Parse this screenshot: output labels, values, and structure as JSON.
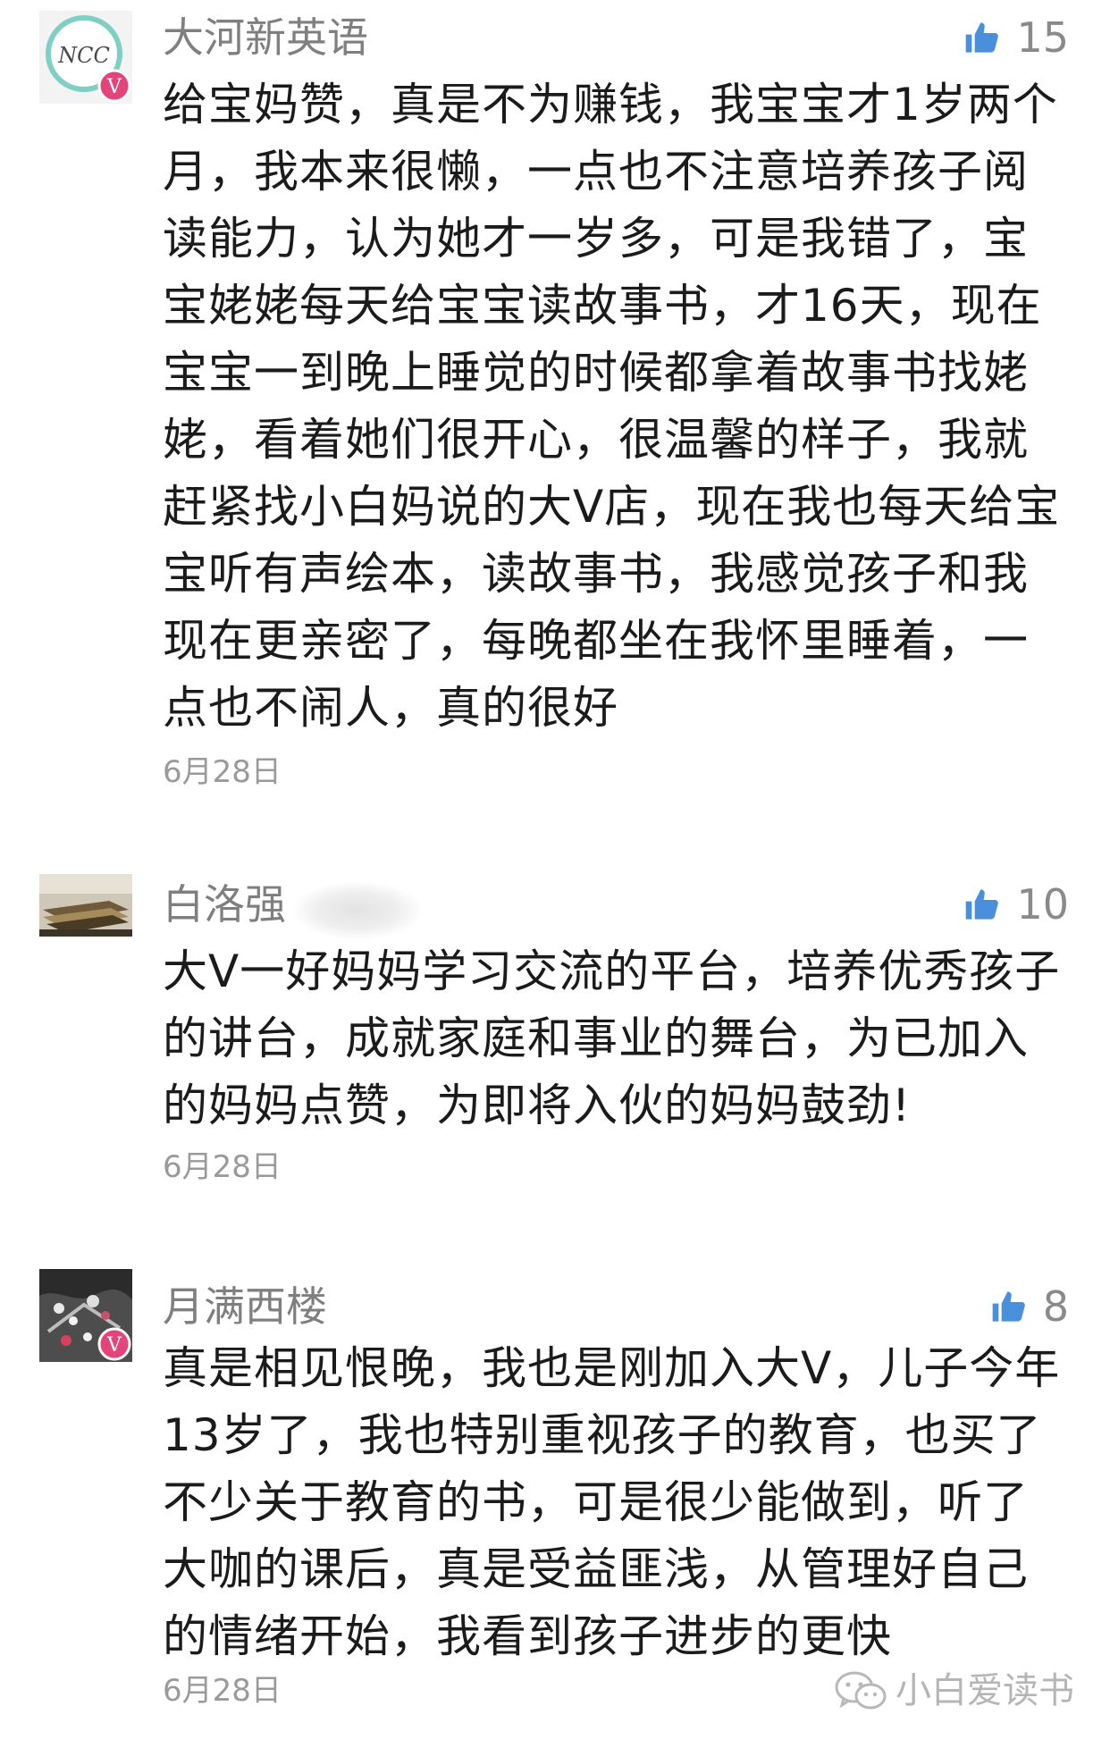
{
  "comments": [
    {
      "author": "大河新英语",
      "likes": "15",
      "avatar_badge": "V",
      "avatar_logo": "NCC",
      "lines": [
        "给宝妈赞，真是不为赚钱，我宝宝才1岁两个",
        "月，我本来很懒，一点也不注意培养孩子阅",
        "读能力，认为她才一岁多，可是我错了，宝",
        "宝姥姥每天给宝宝读故事书，才16天，现在",
        "宝宝一到晚上睡觉的时候都拿着故事书找姥",
        "姥，看着她们很开心，很温馨的样子，我就",
        "赶紧找小白妈说的大V店，现在我也每天给宝",
        "宝听有声绘本，读故事书，我感觉孩子和我",
        "现在更亲密了，每晚都坐在我怀里睡着，一",
        "点也不闹人，真的很好"
      ],
      "date": "6月28日"
    },
    {
      "author": "白洛强",
      "likes": "10",
      "lines": [
        "大V一好妈妈学习交流的平台，培养优秀孩子",
        "的讲台，成就家庭和事业的舞台，为已加入",
        "的妈妈点赞，为即将入伙的妈妈鼓劲!"
      ],
      "date": "6月28日"
    },
    {
      "author": "月满西楼",
      "likes": "8",
      "avatar_badge": "V",
      "lines": [
        "真是相见恨晚，我也是刚加入大V，儿子今年",
        "13岁了，我也特别重视孩子的教育，也买了",
        "不少关于教育的书，可是很少能做到，听了",
        "大咖的课后，真是受益匪浅，从管理好自己",
        "的情绪开始，我看到孩子进步的更快"
      ],
      "date": "6月28日"
    }
  ],
  "watermark": "小白爱读书",
  "icons": {
    "like": "thumbs-up-icon",
    "watermark": "wechat-logo-icon"
  },
  "colors": {
    "like_icon": "#4a8fdc",
    "name": "#7f7f7f",
    "date": "#9a9a9a",
    "badge": "#e3457a"
  }
}
